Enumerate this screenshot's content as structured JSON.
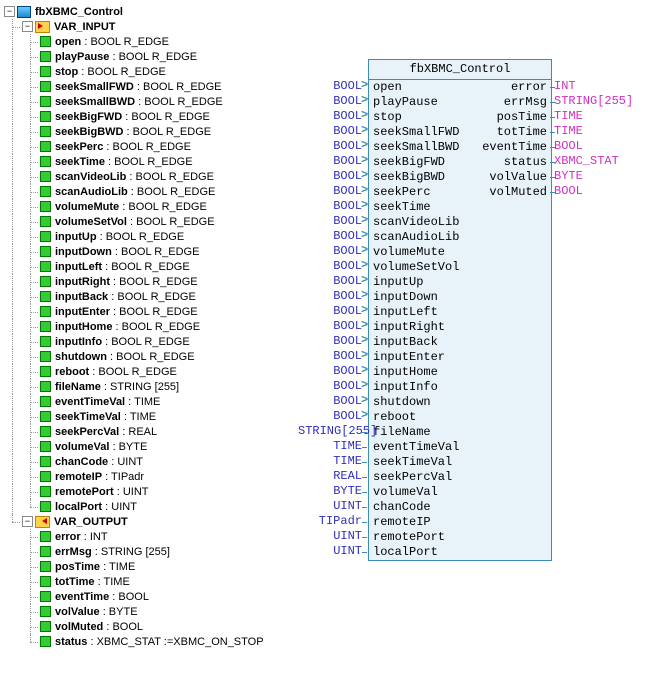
{
  "root": {
    "name": "fbXBMC_Control"
  },
  "sections": {
    "var_input": "VAR_INPUT",
    "var_output": "VAR_OUTPUT"
  },
  "inputs": [
    {
      "name": "open",
      "type": "BOOL R_EDGE"
    },
    {
      "name": "playPause",
      "type": "BOOL R_EDGE"
    },
    {
      "name": "stop",
      "type": "BOOL R_EDGE"
    },
    {
      "name": "seekSmallFWD",
      "type": "BOOL R_EDGE"
    },
    {
      "name": "seekSmallBWD",
      "type": "BOOL R_EDGE"
    },
    {
      "name": "seekBigFWD",
      "type": "BOOL R_EDGE"
    },
    {
      "name": "seekBigBWD",
      "type": "BOOL R_EDGE"
    },
    {
      "name": "seekPerc",
      "type": "BOOL R_EDGE"
    },
    {
      "name": "seekTime",
      "type": "BOOL R_EDGE"
    },
    {
      "name": "scanVideoLib",
      "type": "BOOL R_EDGE"
    },
    {
      "name": "scanAudioLib",
      "type": "BOOL R_EDGE"
    },
    {
      "name": "volumeMute",
      "type": "BOOL R_EDGE"
    },
    {
      "name": "volumeSetVol",
      "type": "BOOL R_EDGE"
    },
    {
      "name": "inputUp",
      "type": "BOOL R_EDGE"
    },
    {
      "name": "inputDown",
      "type": "BOOL R_EDGE"
    },
    {
      "name": "inputLeft",
      "type": "BOOL R_EDGE"
    },
    {
      "name": "inputRight",
      "type": "BOOL R_EDGE"
    },
    {
      "name": "inputBack",
      "type": "BOOL R_EDGE"
    },
    {
      "name": "inputEnter",
      "type": "BOOL R_EDGE"
    },
    {
      "name": "inputHome",
      "type": "BOOL R_EDGE"
    },
    {
      "name": "inputInfo",
      "type": "BOOL R_EDGE"
    },
    {
      "name": "shutdown",
      "type": "BOOL R_EDGE"
    },
    {
      "name": "reboot",
      "type": "BOOL R_EDGE"
    },
    {
      "name": "fileName",
      "type": "STRING [255]"
    },
    {
      "name": "eventTimeVal",
      "type": "TIME"
    },
    {
      "name": "seekTimeVal",
      "type": "TIME"
    },
    {
      "name": "seekPercVal",
      "type": "REAL"
    },
    {
      "name": "volumeVal",
      "type": "BYTE"
    },
    {
      "name": "chanCode",
      "type": "UINT"
    },
    {
      "name": "remoteIP",
      "type": "TIPadr"
    },
    {
      "name": "remotePort",
      "type": "UINT"
    },
    {
      "name": "localPort",
      "type": "UINT"
    }
  ],
  "outputs": [
    {
      "name": "error",
      "type": "INT"
    },
    {
      "name": "errMsg",
      "type": "STRING [255]"
    },
    {
      "name": "posTime",
      "type": "TIME"
    },
    {
      "name": "totTime",
      "type": "TIME"
    },
    {
      "name": "eventTime",
      "type": "BOOL"
    },
    {
      "name": "volValue",
      "type": "BYTE"
    },
    {
      "name": "volMuted",
      "type": "BOOL"
    },
    {
      "name": "status",
      "type": "XBMC_STAT",
      "init": "XBMC_ON_STOP"
    }
  ],
  "fbd": {
    "title": "fbXBMC_Control",
    "inputs": [
      {
        "name": "open",
        "type": "BOOL",
        "arrow": true
      },
      {
        "name": "playPause",
        "type": "BOOL",
        "arrow": true
      },
      {
        "name": "stop",
        "type": "BOOL",
        "arrow": true
      },
      {
        "name": "seekSmallFWD",
        "type": "BOOL",
        "arrow": true
      },
      {
        "name": "seekSmallBWD",
        "type": "BOOL",
        "arrow": true
      },
      {
        "name": "seekBigFWD",
        "type": "BOOL",
        "arrow": true
      },
      {
        "name": "seekBigBWD",
        "type": "BOOL",
        "arrow": true
      },
      {
        "name": "seekPerc",
        "type": "BOOL",
        "arrow": true
      },
      {
        "name": "seekTime",
        "type": "BOOL",
        "arrow": true
      },
      {
        "name": "scanVideoLib",
        "type": "BOOL",
        "arrow": true
      },
      {
        "name": "scanAudioLib",
        "type": "BOOL",
        "arrow": true
      },
      {
        "name": "volumeMute",
        "type": "BOOL",
        "arrow": true
      },
      {
        "name": "volumeSetVol",
        "type": "BOOL",
        "arrow": true
      },
      {
        "name": "inputUp",
        "type": "BOOL",
        "arrow": true
      },
      {
        "name": "inputDown",
        "type": "BOOL",
        "arrow": true
      },
      {
        "name": "inputLeft",
        "type": "BOOL",
        "arrow": true
      },
      {
        "name": "inputRight",
        "type": "BOOL",
        "arrow": true
      },
      {
        "name": "inputBack",
        "type": "BOOL",
        "arrow": true
      },
      {
        "name": "inputEnter",
        "type": "BOOL",
        "arrow": true
      },
      {
        "name": "inputHome",
        "type": "BOOL",
        "arrow": true
      },
      {
        "name": "inputInfo",
        "type": "BOOL",
        "arrow": true
      },
      {
        "name": "shutdown",
        "type": "BOOL",
        "arrow": true
      },
      {
        "name": "reboot",
        "type": "BOOL",
        "arrow": true
      },
      {
        "name": "fileName",
        "type": "STRING[255]",
        "arrow": false
      },
      {
        "name": "eventTimeVal",
        "type": "TIME",
        "arrow": false
      },
      {
        "name": "seekTimeVal",
        "type": "TIME",
        "arrow": false
      },
      {
        "name": "seekPercVal",
        "type": "REAL",
        "arrow": false
      },
      {
        "name": "volumeVal",
        "type": "BYTE",
        "arrow": false
      },
      {
        "name": "chanCode",
        "type": "UINT",
        "arrow": false
      },
      {
        "name": "remoteIP",
        "type": "TIPadr",
        "arrow": false
      },
      {
        "name": "remotePort",
        "type": "UINT",
        "arrow": false
      },
      {
        "name": "localPort",
        "type": "UINT",
        "arrow": false
      }
    ],
    "outputs": [
      {
        "name": "error",
        "type": "INT"
      },
      {
        "name": "errMsg",
        "type": "STRING[255]"
      },
      {
        "name": "posTime",
        "type": "TIME"
      },
      {
        "name": "totTime",
        "type": "TIME"
      },
      {
        "name": "eventTime",
        "type": "BOOL"
      },
      {
        "name": "status",
        "type": "XBMC_STAT"
      },
      {
        "name": "volValue",
        "type": "BYTE"
      },
      {
        "name": "volMuted",
        "type": "BOOL"
      }
    ]
  }
}
